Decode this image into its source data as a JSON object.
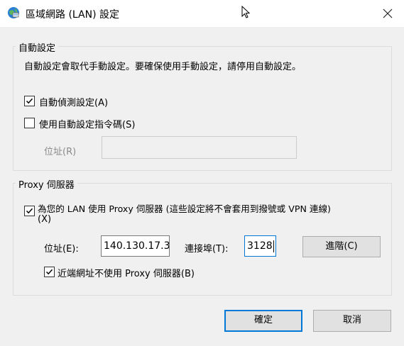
{
  "window": {
    "title": "區域網路 (LAN) 設定"
  },
  "auto_config": {
    "group_label": "自動設定",
    "description": "自動設定會取代手動設定。要確保使用手動設定，請停用自動設定。",
    "auto_detect": {
      "label": "自動偵測設定(A)",
      "checked": true
    },
    "use_script": {
      "label": "使用自動設定指令碼(S)",
      "checked": false
    },
    "address_label": "位址(R)",
    "address_value": ""
  },
  "proxy": {
    "group_label": "Proxy 伺服器",
    "use_proxy": {
      "label_line1": "為您的 LAN 使用 Proxy 伺服器 (這些設定將不會套用到撥號或 VPN 連線)",
      "label_line2": "(X)",
      "checked": true
    },
    "address_label": "位址(E):",
    "address_value": "140.130.17.3",
    "port_label": "連接埠(T):",
    "port_value": "3128",
    "advanced_button": "進階(C)",
    "bypass_local": {
      "label": "近端網址不使用 Proxy 伺服器(B)",
      "checked": true
    }
  },
  "buttons": {
    "ok": "確定",
    "cancel": "取消"
  },
  "colors": {
    "accent": "#0078d7",
    "dialog_bg": "#f0f0f0",
    "button_bg": "#e1e1e1"
  }
}
